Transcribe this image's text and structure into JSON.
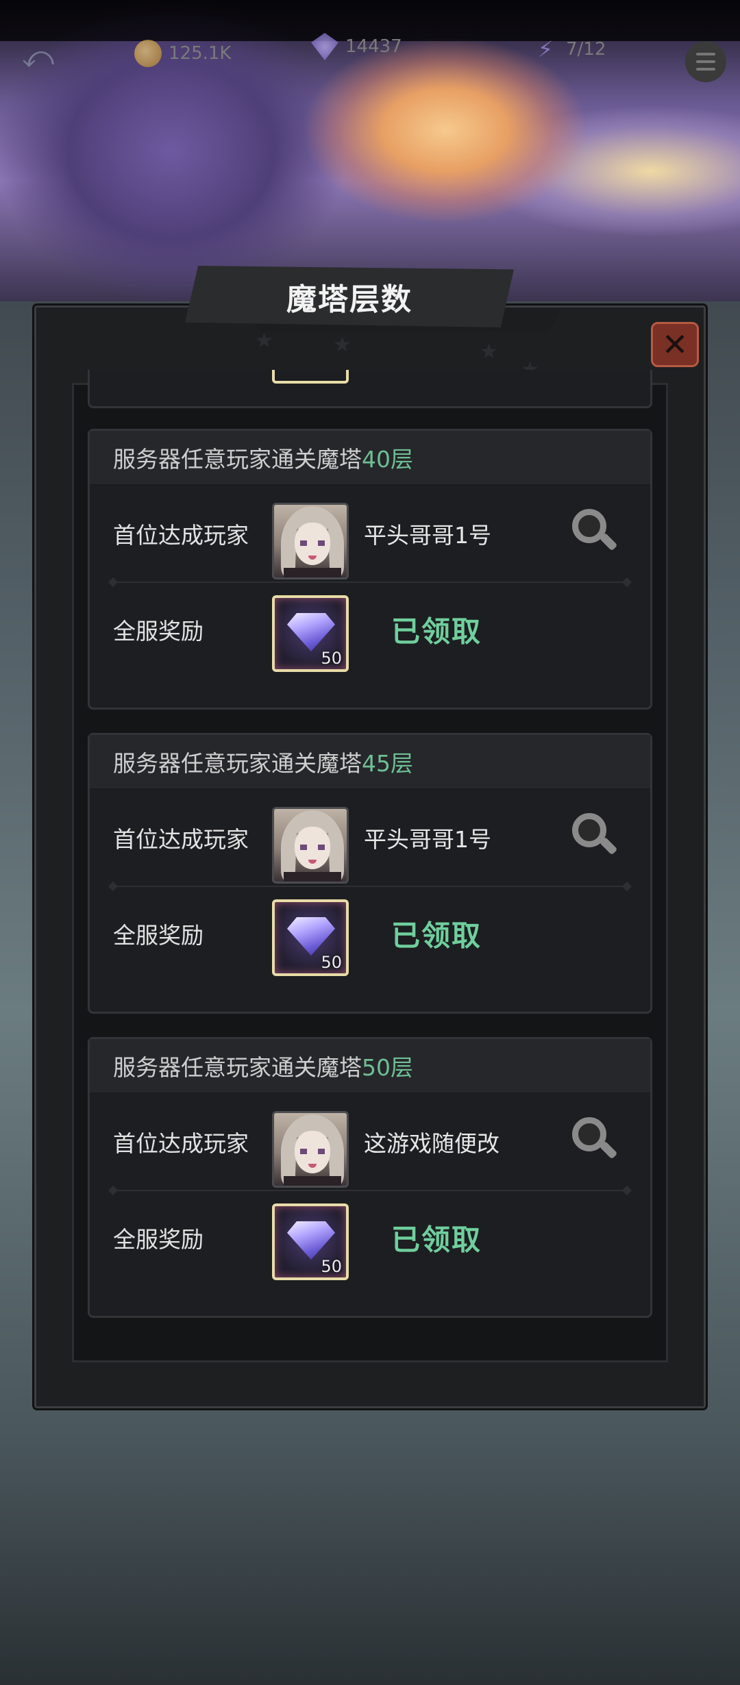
{
  "page": {
    "title": "魔塔层数",
    "close_icon": "close-icon"
  },
  "top_bar": {
    "resources": [
      {
        "icon": "coin-icon",
        "value": "125.1K"
      },
      {
        "icon": "gem-icon",
        "value": "14437"
      },
      {
        "icon": "energy-icon",
        "value": "7/12"
      }
    ]
  },
  "labels": {
    "first_player": "首位达成玩家",
    "server_reward": "全服奖励",
    "claimed": "已领取",
    "title_prefix": "服务器任意玩家通关魔塔"
  },
  "achievements": [
    {
      "floor": "40层",
      "player": "平头哥哥1号",
      "reward_count": "50"
    },
    {
      "floor": "45层",
      "player": "平头哥哥1号",
      "reward_count": "50"
    },
    {
      "floor": "50层",
      "player": "这游戏随便改",
      "reward_count": "50"
    }
  ],
  "colors": {
    "accent_green": "#6fcf9d",
    "close_red": "#7a3025",
    "reward_frame": "#e8dca8"
  }
}
